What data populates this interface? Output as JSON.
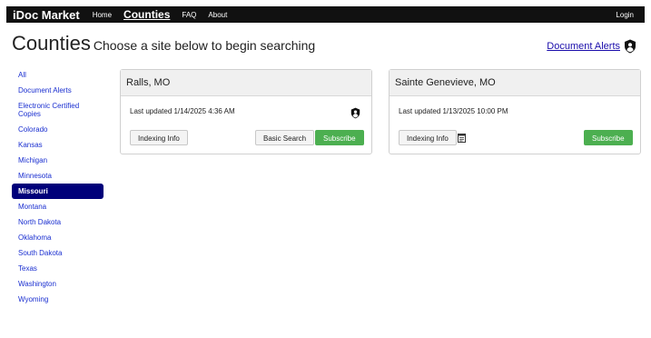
{
  "nav": {
    "brand": "iDoc Market",
    "home": "Home",
    "counties": "Counties",
    "faq": "FAQ",
    "about": "About",
    "login": "Login"
  },
  "header": {
    "title": "Counties",
    "subtitle": "Choose a site below to begin searching",
    "document_alerts": "Document Alerts"
  },
  "sidebar": {
    "items": [
      "All",
      "Document Alerts",
      "Electronic Certified Copies",
      "Colorado",
      "Kansas",
      "Michigan",
      "Minnesota",
      "Missouri",
      "Montana",
      "North Dakota",
      "Oklahoma",
      "South Dakota",
      "Texas",
      "Washington",
      "Wyoming"
    ],
    "selected": "Missouri"
  },
  "cards": [
    {
      "name": "Ralls, MO",
      "updated": "Last updated 1/14/2025 4:36 AM",
      "indexing": "Indexing Info",
      "basic_search": "Basic Search",
      "subscribe": "Subscribe"
    },
    {
      "name": "Sainte Genevieve, MO",
      "updated": "Last updated 1/13/2025 10:00 PM",
      "indexing": "Indexing Info",
      "subscribe": "Subscribe"
    }
  ],
  "icons": {
    "alert": "shield-user-icon",
    "note": "notepad-icon"
  },
  "colors": {
    "nav_bg": "#111111",
    "selected_bg": "#00007a",
    "link": "#1a2fd0",
    "subscribe": "#4caf50"
  }
}
